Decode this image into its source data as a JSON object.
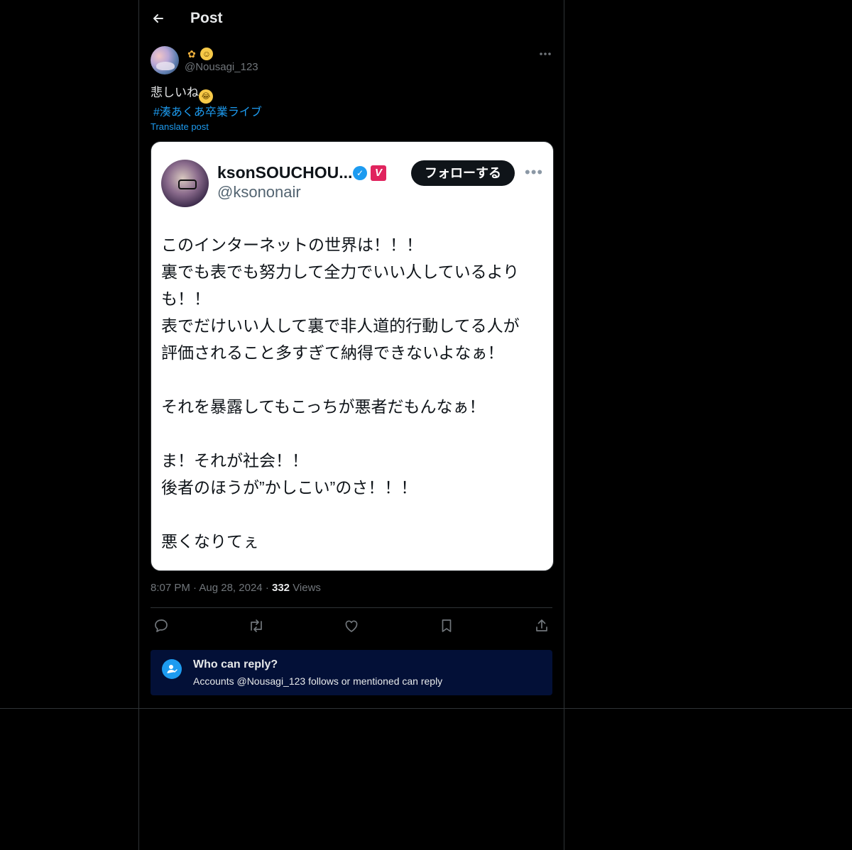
{
  "header": {
    "title": "Post"
  },
  "post": {
    "author": {
      "display_name_emojis": [
        "people-emoji",
        "face-emoji"
      ],
      "handle": "@Nousagi_123"
    },
    "text": "悲しいね",
    "text_emoji": "laughing-emoji",
    "hashtag": "#湊あくあ卒業ライブ",
    "translate_label": "Translate post",
    "time": "8:07 PM",
    "separator": "·",
    "date": "Aug 28, 2024",
    "views_count": "332",
    "views_label": "Views"
  },
  "media": {
    "name": "ksonSOUCHOU...",
    "handle": "@ksononair",
    "follow_label": "フォローする",
    "verified_mark": "✓",
    "v_badge": "V",
    "lines": [
      "このインターネットの世界は！！！",
      "裏でも表でも努力して全力でいい人しているより",
      "も！！",
      "表でだけいい人して裏で非人道的行動してる人が",
      "評価されること多すぎて納得できないよなぁ！",
      "",
      "それを暴露してもこっちが悪者だもんなぁ！",
      "",
      "ま！それが社会！！",
      "後者のほうが”かしこい”のさ！！！",
      "",
      "悪くなりてぇ"
    ]
  },
  "reply_settings": {
    "title": "Who can reply?",
    "subtitle": "Accounts @Nousagi_123 follows or mentioned can reply"
  },
  "icons": {
    "back": "arrow-left-icon",
    "more": "more-icon",
    "reply": "reply-icon",
    "repost": "repost-icon",
    "like": "heart-icon",
    "bookmark": "bookmark-icon",
    "share": "share-icon",
    "who_can_reply": "user-check-icon"
  },
  "colors": {
    "background": "#000000",
    "accent": "#1d9bf0",
    "text_primary": "#e7e9ea",
    "text_secondary": "#71767b",
    "border": "#2f3336",
    "reply_box": "#031037"
  }
}
